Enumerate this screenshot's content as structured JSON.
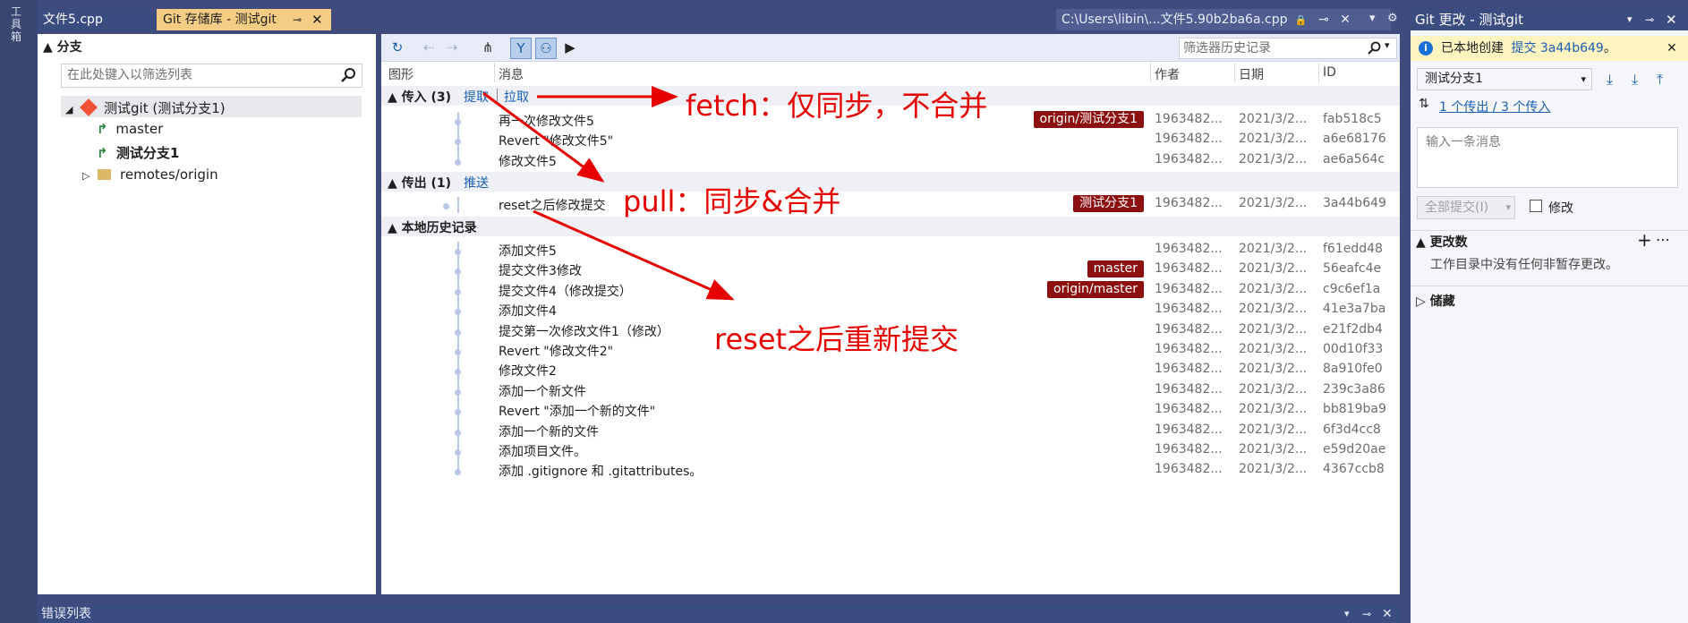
{
  "side_toolbar": {
    "label": "工具箱"
  },
  "document_tabs": [
    {
      "label": "文件5.cpp"
    },
    {
      "label": "Git 存储库 - 测试git",
      "pin": "⊸",
      "close": "✕"
    }
  ],
  "path_tab": {
    "label": "C:\\Users\\libin\\...文件5.90b2ba6a.cpp",
    "lock": "🔒"
  },
  "branches_pane": {
    "header": "分支",
    "filter_placeholder": "在此处键入以筛选列表",
    "repo": "测试git (测试分支1)",
    "branches": [
      "master",
      "测试分支1"
    ],
    "remotes": "remotes/origin"
  },
  "history_pane": {
    "search_placeholder": "筛选器历史记录",
    "columns": {
      "graph": "图形",
      "message": "消息",
      "author": "作者",
      "date": "日期",
      "id": "ID"
    },
    "incoming": {
      "label": "传入 (3)",
      "fetch": "提取",
      "pull": "拉取"
    },
    "outgoing": {
      "label": "传出 (1)",
      "push": "推送"
    },
    "local": {
      "label": "本地历史记录"
    },
    "incoming_rows": [
      {
        "msg": "再一次修改文件5",
        "author": "1963482...",
        "date": "2021/3/2...",
        "id": "fab518c5",
        "badge": "origin/测试分支1"
      },
      {
        "msg": "Revert \"修改文件5\"",
        "author": "1963482...",
        "date": "2021/3/2...",
        "id": "a6e68176",
        "badge": ""
      },
      {
        "msg": "修改文件5",
        "author": "1963482...",
        "date": "2021/3/2...",
        "id": "ae6a564c",
        "badge": ""
      }
    ],
    "outgoing_rows": [
      {
        "msg": "reset之后修改提交",
        "author": "1963482...",
        "date": "2021/3/2...",
        "id": "3a44b649",
        "badge": "测试分支1"
      }
    ],
    "local_rows": [
      {
        "msg": "添加文件5",
        "author": "1963482...",
        "date": "2021/3/2...",
        "id": "f61edd48",
        "badge": ""
      },
      {
        "msg": "提交文件3修改",
        "author": "1963482...",
        "date": "2021/3/2...",
        "id": "56eafc4e",
        "badge": "master"
      },
      {
        "msg": "提交文件4（修改提交）",
        "author": "1963482...",
        "date": "2021/3/2...",
        "id": "c9c6ef1a",
        "badge": "origin/master"
      },
      {
        "msg": "添加文件4",
        "author": "1963482...",
        "date": "2021/3/2...",
        "id": "41e3a7ba",
        "badge": ""
      },
      {
        "msg": "提交第一次修改文件1（修改）",
        "author": "1963482...",
        "date": "2021/3/2...",
        "id": "e21f2db4",
        "badge": ""
      },
      {
        "msg": "Revert \"修改文件2\"",
        "author": "1963482...",
        "date": "2021/3/2...",
        "id": "00d10f33",
        "badge": ""
      },
      {
        "msg": "修改文件2",
        "author": "1963482...",
        "date": "2021/3/2...",
        "id": "8a910fe0",
        "badge": ""
      },
      {
        "msg": "添加一个新文件",
        "author": "1963482...",
        "date": "2021/3/2...",
        "id": "239c3a86",
        "badge": ""
      },
      {
        "msg": "Revert \"添加一个新的文件\"",
        "author": "1963482...",
        "date": "2021/3/2...",
        "id": "bb819ba9",
        "badge": ""
      },
      {
        "msg": "添加一个新的文件",
        "author": "1963482...",
        "date": "2021/3/2...",
        "id": "6f3d4cc8",
        "badge": ""
      },
      {
        "msg": "添加项目文件。",
        "author": "1963482...",
        "date": "2021/3/2...",
        "id": "e59d20ae",
        "badge": ""
      },
      {
        "msg": "添加 .gitignore 和 .gitattributes。",
        "author": "1963482...",
        "date": "2021/3/2...",
        "id": "4367ccb8",
        "badge": ""
      }
    ]
  },
  "annotations": {
    "fetch": "fetch：仅同步，不合并",
    "pull": "pull：同步&合并",
    "reset": "reset之后重新提交"
  },
  "git_changes": {
    "title": "Git 更改 - 测试git",
    "info_prefix": "已本地创建",
    "info_link": "提交 3a44b649",
    "info_suffix": "。",
    "branch": "测试分支1",
    "sync_link": "1 个传出 / 3 个传入",
    "message_placeholder": "输入一条消息",
    "commit_all": "全部提交(I)",
    "amend": "修改",
    "changes_header": "更改数",
    "changes_empty": "工作目录中没有任何非暂存更改。",
    "stashes_header": "储藏"
  },
  "error_list": {
    "label": "错误列表"
  },
  "colors": {
    "accent": "#1a5fb4",
    "badge": "#8c1010",
    "annotation": "#e60000",
    "active_tab": "#f5cc84"
  }
}
